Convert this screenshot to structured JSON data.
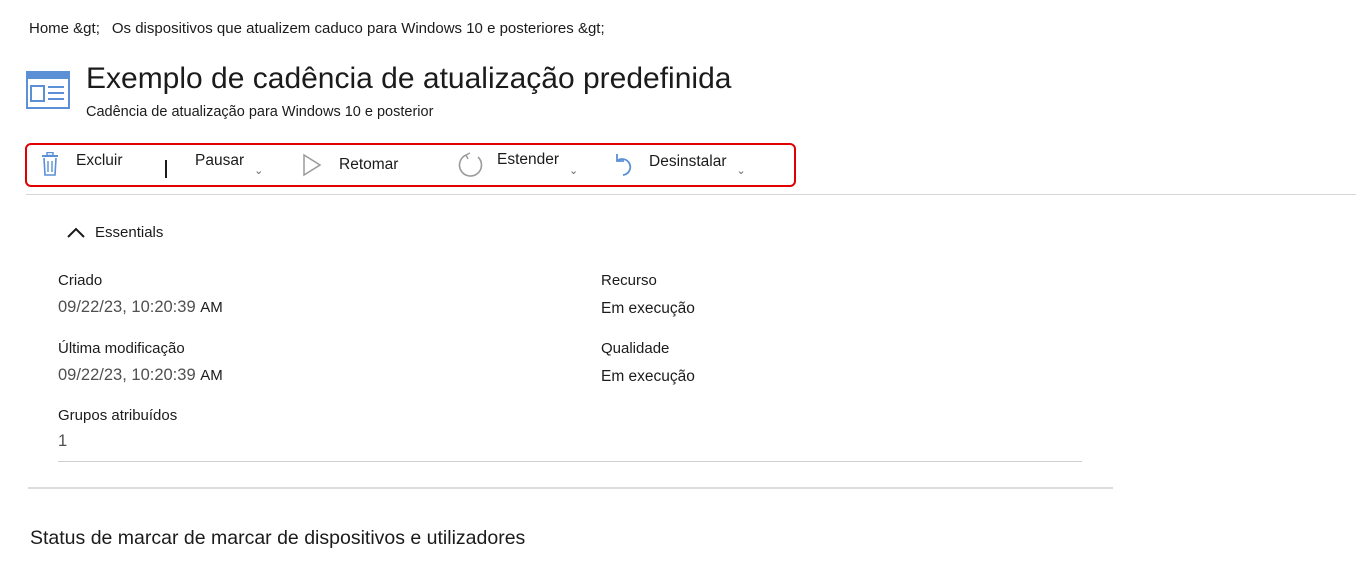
{
  "breadcrumb": {
    "home": "Home &gt;",
    "current": "Os dispositivos que atualizem caduco para Windows 10 e posteriores &gt;"
  },
  "header": {
    "title": "Exemplo de cadência de atualização predefinida",
    "subtitle": "Cadência de atualização para Windows 10 e posterior",
    "icon": "page-blade-icon"
  },
  "toolbar": {
    "delete_label": "Excluir",
    "pause_label": "Pausar",
    "resume_label": "Retomar",
    "extend_label": "Estender",
    "uninstall_label": "Desinstalar",
    "highlight_color": "#e00000",
    "icon_color": "#5b8fd6"
  },
  "essentials": {
    "toggle_label": "Essentials",
    "created_label": "Criado",
    "created_value": "09/22/23, 10:20:39",
    "created_suffix": "AM",
    "modified_label": "Última modificação",
    "modified_value": "09/22/23, 10:20:39",
    "modified_suffix": "AM",
    "groups_label": "Grupos atribuídos",
    "groups_value": "1",
    "feature_label": "Recurso",
    "feature_value": "Em execução",
    "quality_label": "Qualidade",
    "quality_value": "Em execução"
  },
  "status_section": {
    "title": "Status de marcar de marcar de dispositivos e utilizadores"
  }
}
